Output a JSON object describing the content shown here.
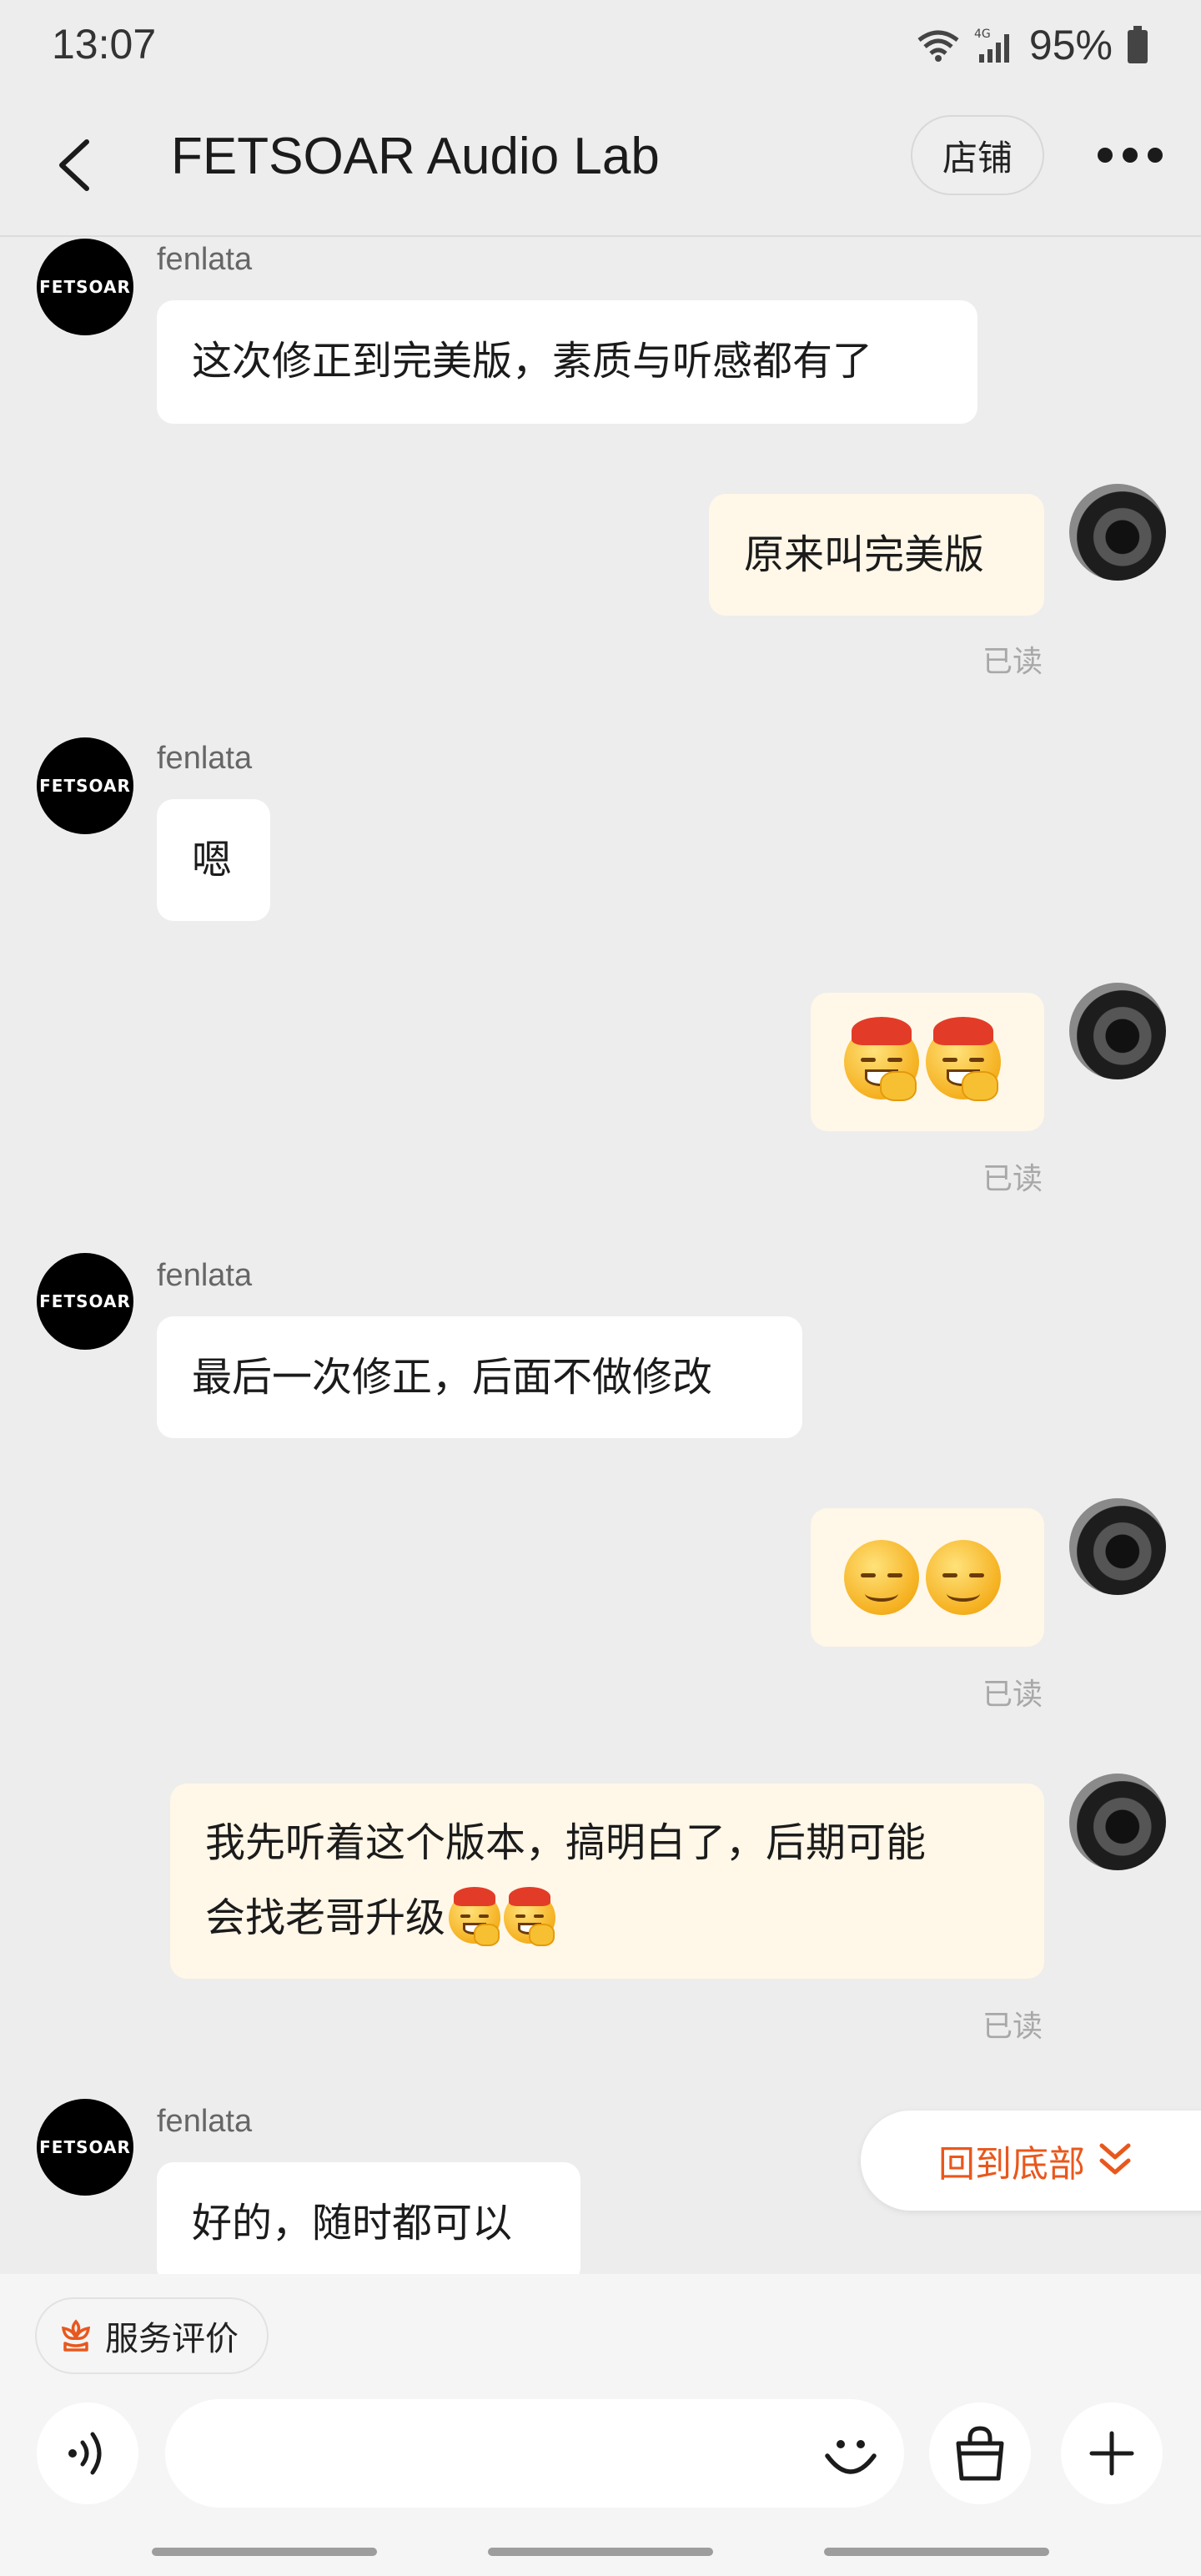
{
  "status_bar": {
    "time": "13:07",
    "battery": "95%",
    "network": "4G"
  },
  "header": {
    "back_icon": "chevron-left-icon",
    "title": "FETSOAR Audio Lab",
    "store_label": "店铺",
    "more_icon": "more-dots-icon"
  },
  "store_avatar_text": "FETSOAR",
  "messages": [
    {
      "from": "store",
      "sender": "fenlata",
      "text": "这次修正到完美版，素质与听感都有了"
    },
    {
      "from": "user",
      "text": "原来叫完美版",
      "read": "已读"
    },
    {
      "from": "store",
      "sender": "fenlata",
      "text": "嗯"
    },
    {
      "from": "user",
      "emoji": "laughing-covering-mouth-emoji x2",
      "read": "已读"
    },
    {
      "from": "store",
      "sender": "fenlata",
      "text": "最后一次修正，后面不做修改"
    },
    {
      "from": "user",
      "emoji": "smirk-emoji x2",
      "read": "已读"
    },
    {
      "from": "user",
      "text_line1": "我先听着这个版本，搞明白了，后期可能",
      "text_line2": "会找老哥升级",
      "read": "已读"
    },
    {
      "from": "store",
      "sender": "fenlata",
      "text": "好的，随时都可以"
    }
  ],
  "back_to_bottom": "回到底部",
  "bottom_bar": {
    "service_rating": "服务评价",
    "voice_icon": "voice-icon",
    "input_placeholder": "",
    "emoji_icon": "smile-icon",
    "bag_icon": "shopping-bag-icon",
    "add_icon": "plus-icon"
  },
  "colors": {
    "background": "#ededed",
    "incoming_bubble": "#ffffff",
    "outgoing_bubble": "#fff7e8",
    "accent": "#e8581d"
  }
}
